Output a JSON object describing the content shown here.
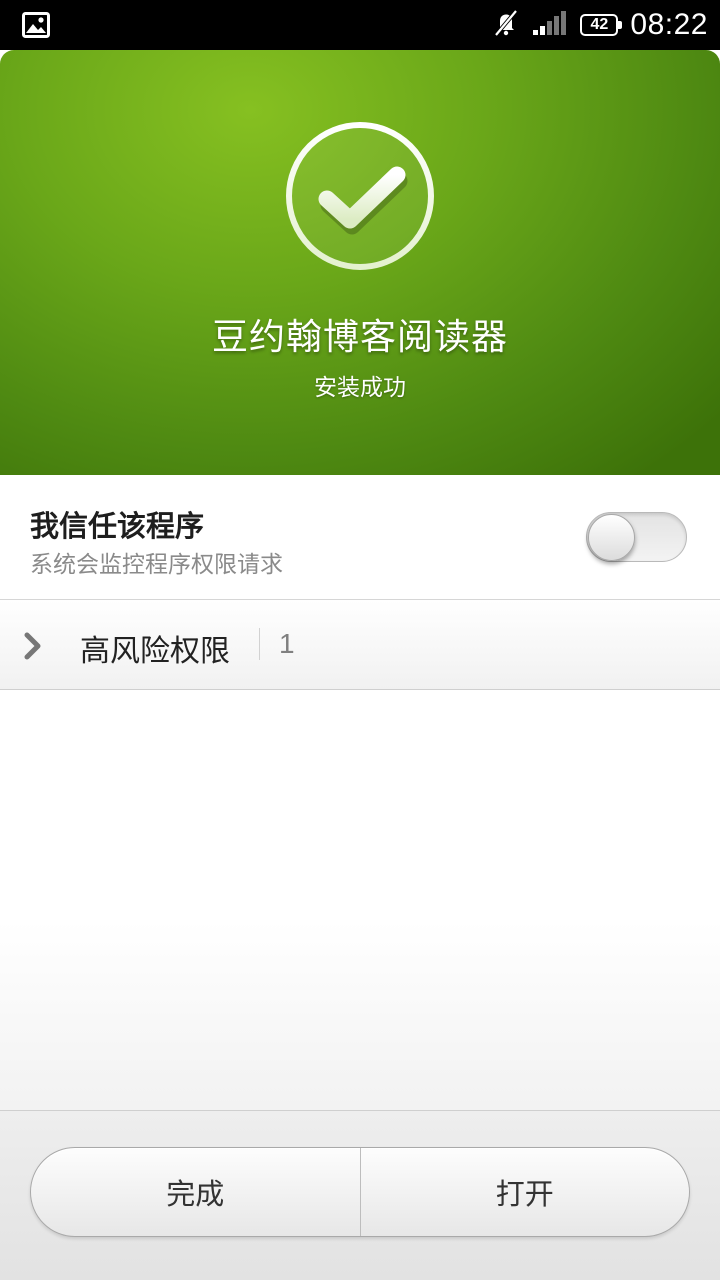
{
  "status_bar": {
    "time": "08:22",
    "battery_level": "42",
    "icons": [
      "gallery-icon",
      "notification-muted-icon",
      "signal-icon",
      "battery-icon"
    ]
  },
  "header": {
    "app_name": "豆约翰博客阅读器",
    "status": "安装成功",
    "icon": "checkmark-circle-icon",
    "accent_color": "#6aa719"
  },
  "trust": {
    "title": "我信任该程序",
    "description": "系统会监控程序权限请求",
    "toggle_on": false
  },
  "permissions": {
    "label": "高风险权限",
    "count": "1",
    "icon": "chevron-right-icon"
  },
  "actions": {
    "done_label": "完成",
    "open_label": "打开"
  }
}
